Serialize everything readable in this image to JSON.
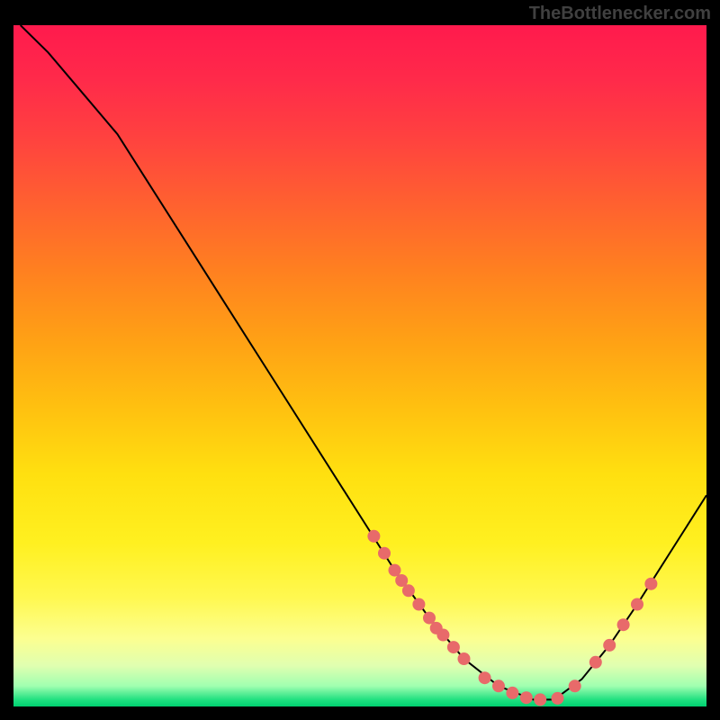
{
  "attribution": "TheBottlenecker.com",
  "chart_data": {
    "type": "line",
    "title": "",
    "xlabel": "",
    "ylabel": "",
    "xlim": [
      0,
      100
    ],
    "ylim": [
      0,
      100
    ],
    "curve": [
      {
        "x": 1,
        "y": 100
      },
      {
        "x": 5,
        "y": 96
      },
      {
        "x": 10,
        "y": 90
      },
      {
        "x": 15,
        "y": 84
      },
      {
        "x": 20,
        "y": 76
      },
      {
        "x": 25,
        "y": 68
      },
      {
        "x": 30,
        "y": 60
      },
      {
        "x": 35,
        "y": 52
      },
      {
        "x": 40,
        "y": 44
      },
      {
        "x": 45,
        "y": 36
      },
      {
        "x": 50,
        "y": 28
      },
      {
        "x": 55,
        "y": 20
      },
      {
        "x": 60,
        "y": 13
      },
      {
        "x": 65,
        "y": 7
      },
      {
        "x": 70,
        "y": 3
      },
      {
        "x": 75,
        "y": 1
      },
      {
        "x": 78,
        "y": 1
      },
      {
        "x": 82,
        "y": 4
      },
      {
        "x": 86,
        "y": 9
      },
      {
        "x": 90,
        "y": 15
      },
      {
        "x": 95,
        "y": 23
      },
      {
        "x": 100,
        "y": 31
      }
    ],
    "markers": [
      {
        "x": 52,
        "y": 25
      },
      {
        "x": 53.5,
        "y": 22.5
      },
      {
        "x": 55,
        "y": 20
      },
      {
        "x": 56,
        "y": 18.5
      },
      {
        "x": 57,
        "y": 17
      },
      {
        "x": 58.5,
        "y": 15
      },
      {
        "x": 60,
        "y": 13
      },
      {
        "x": 61,
        "y": 11.5
      },
      {
        "x": 62,
        "y": 10.5
      },
      {
        "x": 63.5,
        "y": 8.7
      },
      {
        "x": 65,
        "y": 7
      },
      {
        "x": 68,
        "y": 4.2
      },
      {
        "x": 70,
        "y": 3
      },
      {
        "x": 72,
        "y": 2
      },
      {
        "x": 74,
        "y": 1.3
      },
      {
        "x": 76,
        "y": 1
      },
      {
        "x": 78.5,
        "y": 1.2
      },
      {
        "x": 81,
        "y": 3
      },
      {
        "x": 84,
        "y": 6.5
      },
      {
        "x": 86,
        "y": 9
      },
      {
        "x": 88,
        "y": 12
      },
      {
        "x": 90,
        "y": 15
      },
      {
        "x": 92,
        "y": 18
      }
    ],
    "colors": {
      "curve": "#000000",
      "marker_fill": "#e86a6a",
      "marker_stroke": "#d04848"
    }
  }
}
